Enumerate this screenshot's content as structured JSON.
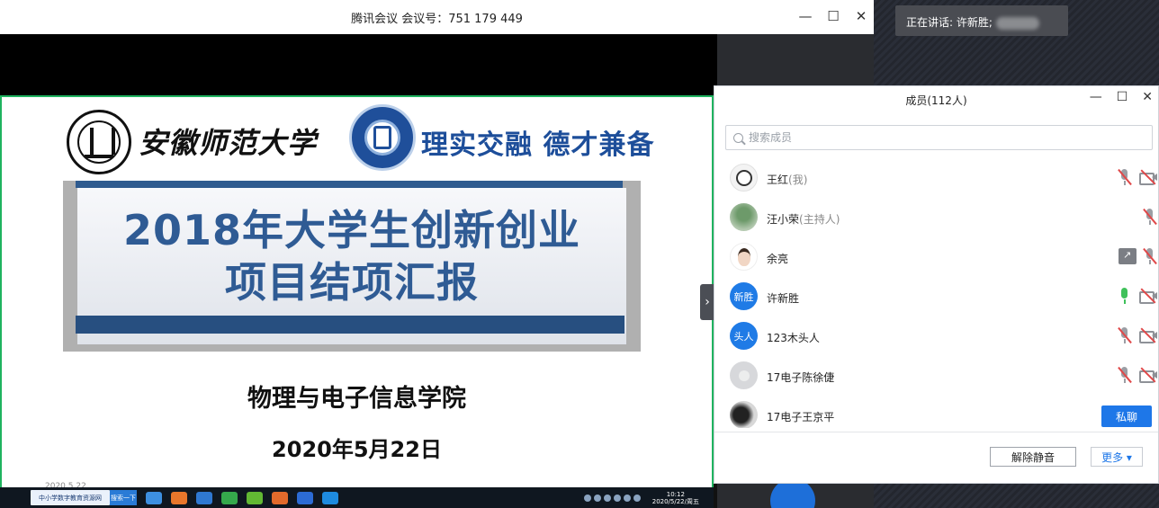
{
  "window": {
    "title": "腾讯会议 会议号：751 179 449",
    "minimize": "—",
    "maximize": "☐",
    "close": "✕"
  },
  "slide": {
    "university_name": "安徽师范大学",
    "motto": "理实交融 德才兼备",
    "title_line1": "2018年大学生创新创业",
    "title_line2": "项目结项汇报",
    "college": "物理与电子信息学院",
    "date": "2020年5月22日",
    "date_small": "2020.5.22"
  },
  "speaker": {
    "label": "正在讲话: 许新胜;"
  },
  "members_panel": {
    "title": "成员(112人)",
    "search_placeholder": "搜索成员",
    "members": [
      {
        "name": "王红",
        "tag": "(我)",
        "avatar": "cartoon",
        "initials": ""
      },
      {
        "name": "汪小荣",
        "tag": "(主持人)",
        "avatar": "photo",
        "initials": ""
      },
      {
        "name": "余亮",
        "tag": "",
        "avatar": "face",
        "initials": ""
      },
      {
        "name": "许新胜",
        "tag": "",
        "avatar": "blue",
        "initials": "新胜"
      },
      {
        "name": "123木头人",
        "tag": "",
        "avatar": "blue",
        "initials": "头人"
      },
      {
        "name": "17电子陈徐倢",
        "tag": "",
        "avatar": "gray",
        "initials": ""
      },
      {
        "name": "17电子王京平",
        "tag": "",
        "avatar": "dark",
        "initials": ""
      }
    ],
    "private_chat_label": "私聊",
    "unmute_label": "解除静音",
    "more_label": "更多 ▾"
  },
  "taskbar": {
    "ie_tab": "中小学数字教育资源网",
    "ie_btn": "搜索一下",
    "clock_time": "10:12",
    "clock_date": "2020/5/22/周五"
  },
  "colors": {
    "accent_blue": "#1e77e8",
    "mute_red": "#e0494a",
    "mic_green": "#3fc15a",
    "slide_title": "#2f5b94",
    "share_border": "#1fb35f"
  }
}
